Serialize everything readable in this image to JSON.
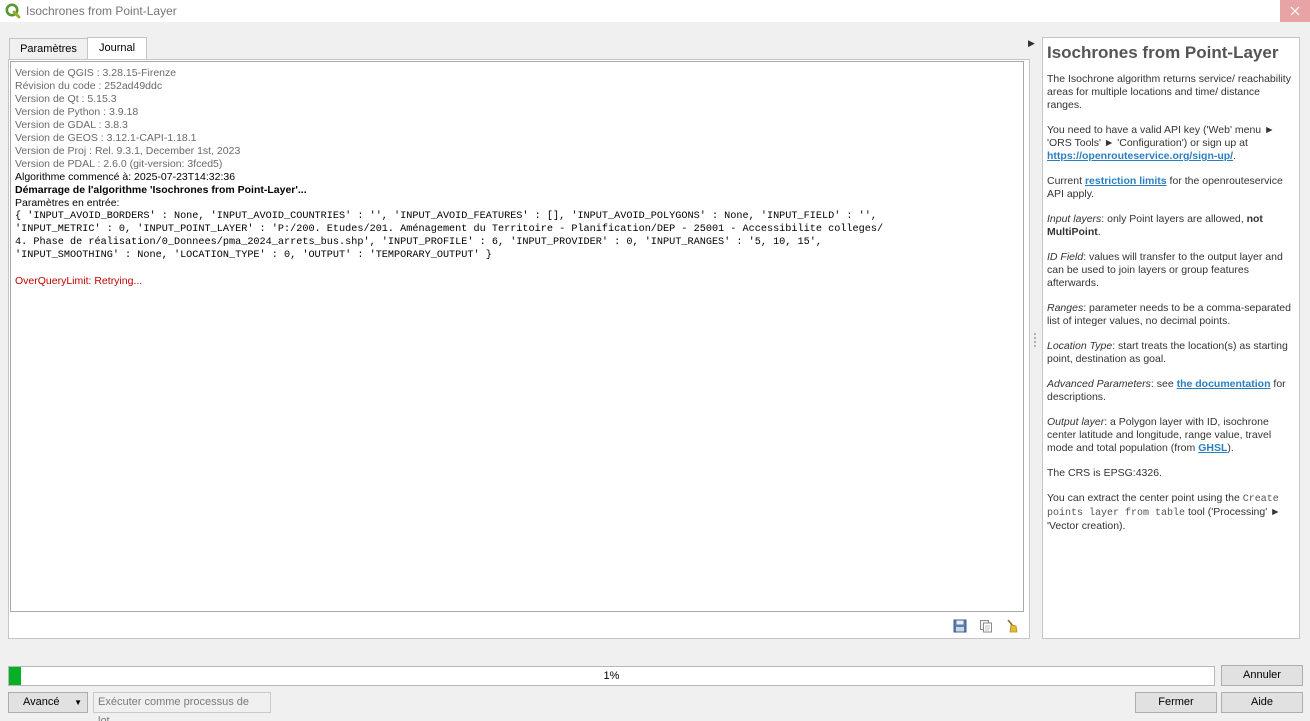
{
  "window": {
    "title": "Isochrones from Point-Layer"
  },
  "tabs": [
    {
      "label": "Paramètres"
    },
    {
      "label": "Journal"
    }
  ],
  "log": {
    "version_lines": [
      "Version de QGIS : 3.28.15-Firenze",
      "Révision du code : 252ad49ddc",
      "Version de Qt : 5.15.3",
      "Version de Python : 3.9.18",
      "Version de GDAL : 3.8.3",
      "Version de GEOS : 3.12.1-CAPI-1.18.1",
      "Version de Proj : Rel. 9.3.1, December 1st, 2023",
      "Version de PDAL : 2.6.0 (git-version: 3fced5)"
    ],
    "started": "Algorithme commencé à: 2025-07-23T14:32:36",
    "start_bold": "Démarrage de l'algorithme 'Isochrones from Point-Layer'...",
    "params_label": "Paramètres en entrée:",
    "params_lines": [
      "{ 'INPUT_AVOID_BORDERS' : None, 'INPUT_AVOID_COUNTRIES' : '', 'INPUT_AVOID_FEATURES' : [], 'INPUT_AVOID_POLYGONS' : None, 'INPUT_FIELD' : '',",
      "'INPUT_METRIC' : 0, 'INPUT_POINT_LAYER' : 'P:/200. Etudes/201. Aménagement du Territoire - Planification/DEP - 25001 - Accessibilite colleges/",
      "4. Phase de réalisation/0_Donnees/pma_2024_arrets_bus.shp', 'INPUT_PROFILE' : 6, 'INPUT_PROVIDER' : 0, 'INPUT_RANGES' : '5, 10, 15',",
      "'INPUT_SMOOTHING' : None, 'LOCATION_TYPE' : 0, 'OUTPUT' : 'TEMPORARY_OUTPUT' }"
    ],
    "error": "OverQueryLimit: Retrying..."
  },
  "help": {
    "title": "Isochrones from Point-Layer",
    "p1": "The Isochrone algorithm returns service/ reachability areas for multiple locations and time/ distance ranges.",
    "p2_a": "You need to have a valid API key ('Web' menu ► 'ORS Tools' ► 'Configuration') or sign up at ",
    "p2_link": "https://openrouteservice.org/sign-up/",
    "p2_b": ".",
    "p3_a": "Current ",
    "p3_link": "restriction limits",
    "p3_b": " for the openrouteservice API apply.",
    "p4_em": "Input layers",
    "p4_a": ": only Point layers are allowed, ",
    "p4_bold": "not MultiPoint",
    "p4_b": ".",
    "p5_em": "ID Field",
    "p5_a": ": values will transfer to the output layer and can be used to join layers or group features afterwards.",
    "p6_em": "Ranges",
    "p6_a": ": parameter needs to be a comma-separated list of integer values, no decimal points.",
    "p7_em": "Location Type",
    "p7_a": ": start treats the location(s) as starting point, destination as goal.",
    "p8_em": "Advanced Parameters",
    "p8_a": ": see ",
    "p8_link": "the documentation",
    "p8_b": " for descriptions.",
    "p9_em": "Output layer",
    "p9_a": ": a Polygon layer with ID, isochrone center latitude and longitude, range value, travel mode and total population (from ",
    "p9_link": "GHSL",
    "p9_b": ").",
    "p10": "The CRS is EPSG:4326.",
    "p11_a": "You can extract the center point using the ",
    "p11_code": "Create points layer from table",
    "p11_b": " tool ('Processing' ► 'Vector creation)."
  },
  "progress": {
    "value": 0.01,
    "label": "1%"
  },
  "buttons": {
    "annuler": "Annuler",
    "avance": "Avancé",
    "lot": "Exécuter comme processus de lot...",
    "fermer": "Fermer",
    "aide": "Aide"
  },
  "colors": {
    "progress_fill": "#06b025",
    "link": "#2a7fc0",
    "error": "#c00000"
  },
  "icons": [
    "qgis-logo-icon",
    "close-icon",
    "save-log-icon",
    "copy-log-icon",
    "clear-log-icon",
    "collapse-arrow-icon"
  ]
}
